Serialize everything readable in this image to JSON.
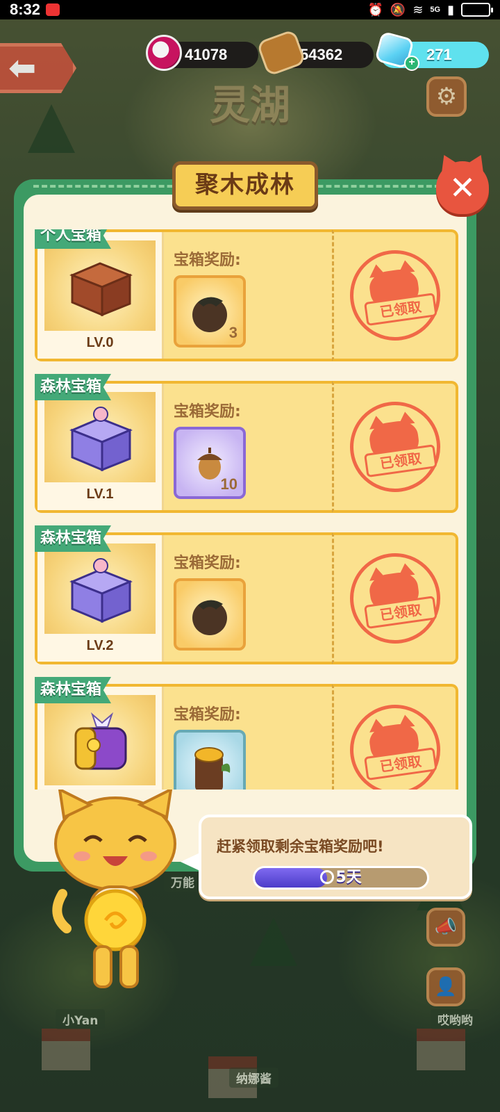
{
  "status_bar": {
    "time": "8:32",
    "network": "5G"
  },
  "resources": {
    "jam": "41078",
    "wood": "54362",
    "gems": "271"
  },
  "location_title": "灵湖",
  "panel": {
    "title": "聚木成林",
    "rows": [
      {
        "chest_name": "个人宝箱",
        "level": "LV.0",
        "reward_label": "宝箱奖励:",
        "reward_qty": "3",
        "claimed_text": "已领取"
      },
      {
        "chest_name": "森林宝箱",
        "level": "LV.1",
        "reward_label": "宝箱奖励:",
        "reward_qty": "10",
        "claimed_text": "已领取"
      },
      {
        "chest_name": "森林宝箱",
        "level": "LV.2",
        "reward_label": "宝箱奖励:",
        "reward_qty": "",
        "claimed_text": "已领取"
      },
      {
        "chest_name": "森林宝箱",
        "level": "",
        "reward_label": "宝箱奖励:",
        "reward_qty": "",
        "claimed_text": "已领取"
      }
    ]
  },
  "bubble": {
    "message": "赶紧领取剩余宝箱奖励吧!",
    "timer": "5天",
    "progress": 0.42
  },
  "map_labels": {
    "left": "小Yan",
    "right": "哎哟哟",
    "bottom": "纳娜酱",
    "middle": "万能"
  },
  "colors": {
    "panel_green": "#3c9a63",
    "card_yellow": "#fbe18e",
    "stamp_red": "#f06847"
  }
}
